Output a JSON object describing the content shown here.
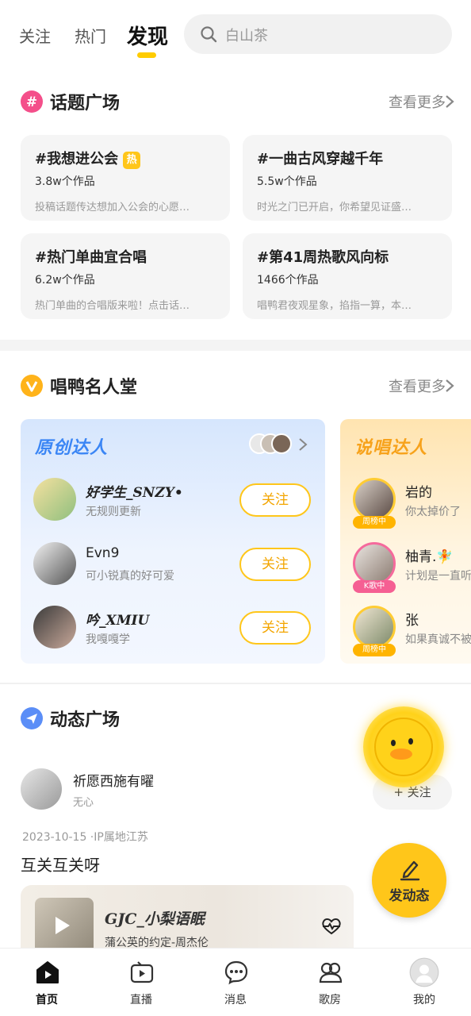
{
  "top_tabs": {
    "follow": "关注",
    "hot": "热门",
    "discover": "发现"
  },
  "search": {
    "placeholder": "白山茶"
  },
  "topics": {
    "title": "话题广场",
    "more": "查看更多",
    "items": [
      {
        "title": "#我想进公会",
        "badge": "热",
        "count": "3.8w个作品",
        "desc": "投稿话题传达想加入公会的心愿…"
      },
      {
        "title": "#一曲古风穿越千年",
        "badge": "",
        "count": "5.5w个作品",
        "desc": "时光之门已开启，你希望见证盛…"
      },
      {
        "title": "#热门单曲宜合唱",
        "badge": "",
        "count": "6.2w个作品",
        "desc": "热门单曲的合唱版来啦！点击话…"
      },
      {
        "title": "#第41周热歌风向标",
        "badge": "",
        "count": "1466个作品",
        "desc": "唱鸭君夜观星象，掐指一算，本…"
      }
    ]
  },
  "fame": {
    "title": "唱鸭名人堂",
    "more": "查看更多",
    "card_a": {
      "title": "原创达人",
      "people": [
        {
          "name": "好学生_SNZY•",
          "desc": "无规则更新",
          "follow": "关注"
        },
        {
          "name": "Evn9",
          "desc": "可小锐真的好可爱",
          "follow": "关注"
        },
        {
          "name": "吟_XMIU",
          "desc": "我嘎嘎学",
          "follow": "关注"
        }
      ]
    },
    "card_b": {
      "title": "说唱达人",
      "people": [
        {
          "name": "岩的",
          "desc": "你太掉价了",
          "tag": "周榜中"
        },
        {
          "name": "柚青.🧚",
          "desc": "计划是一直听",
          "tag": "K歌中"
        },
        {
          "name": "张",
          "desc": "如果真诚不被",
          "tag": "周榜中"
        }
      ]
    }
  },
  "feed": {
    "title": "动态广场",
    "user_name": "祈愿西施有曜",
    "user_sub": "无心",
    "follow": "+ 关注",
    "meta": "2023-10-15 ·IP属地江苏",
    "text": "互关互关呀",
    "song_artist": "GJC_小梨语眠",
    "song_title": "蒲公英的约定-周杰伦"
  },
  "fab": {
    "label": "发动态"
  },
  "bottom_nav": [
    {
      "label": "首页",
      "icon": "home-play-icon"
    },
    {
      "label": "直播",
      "icon": "live-tv-icon"
    },
    {
      "label": "消息",
      "icon": "message-bubble-icon"
    },
    {
      "label": "歌房",
      "icon": "room-people-icon"
    },
    {
      "label": "我的",
      "icon": "profile-avatar-icon"
    }
  ],
  "colors": {
    "accent": "#ffc61a",
    "blue": "#3b86f5",
    "orange": "#f7a21b",
    "pink": "#f55f93"
  }
}
